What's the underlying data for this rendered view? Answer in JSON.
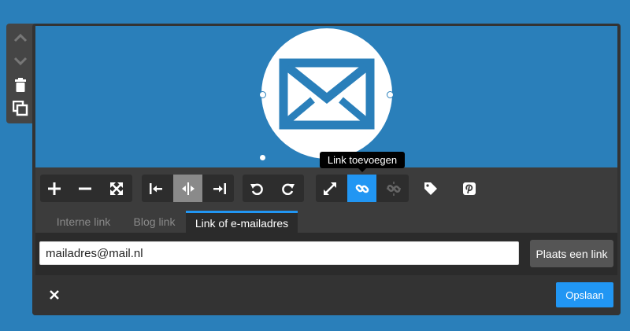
{
  "tooltip": {
    "text": "Link toevoegen"
  },
  "toolbar": {
    "icons": [
      "zoom-in-icon",
      "zoom-out-icon",
      "fullscreen-icon",
      "align-left-icon",
      "align-center-icon",
      "align-right-icon",
      "rotate-left-icon",
      "rotate-right-icon",
      "resize-icon",
      "link-icon",
      "unlink-icon",
      "tag-icon",
      "pinterest-icon"
    ],
    "active_align": "align-center",
    "active_link": "link"
  },
  "tabs": [
    {
      "label": "Interne link",
      "active": false
    },
    {
      "label": "Blog link",
      "active": false
    },
    {
      "label": "Link of e-mailadres",
      "active": true
    }
  ],
  "link_form": {
    "value": "mailadres@mail.nl",
    "button_label": "Plaats een link"
  },
  "footer": {
    "save_label": "Opslaan"
  },
  "colors": {
    "accent": "#2196f3",
    "background": "#2a7fba",
    "panel": "#333333"
  }
}
